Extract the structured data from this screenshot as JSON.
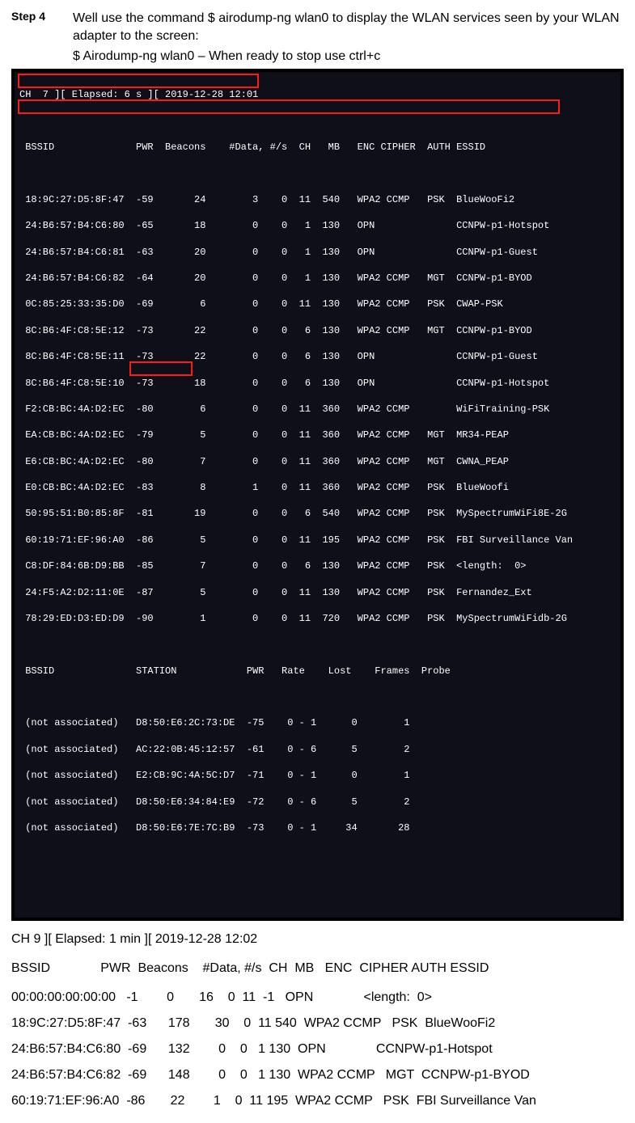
{
  "step": {
    "label": "Step 4",
    "text": "Well use the command $ airodump-ng wlan0 to display the WLAN services seen by your WLAN adapter to the screen:",
    "cmd": "$ Airodump-ng wlan0 – When ready to stop use ctrl+c"
  },
  "terminal": {
    "status": "CH  7 ][ Elapsed: 6 s ][ 2019-12-28 12:01",
    "header": " BSSID              PWR  Beacons    #Data, #/s  CH   MB   ENC CIPHER  AUTH ESSID",
    "rows": [
      " 18:9C:27:D5:8F:47  -59       24        3    0  11  540   WPA2 CCMP   PSK  BlueWooFi2",
      " 24:B6:57:B4:C6:80  -65       18        0    0   1  130   OPN              CCNPW-p1-Hotspot",
      " 24:B6:57:B4:C6:81  -63       20        0    0   1  130   OPN              CCNPW-p1-Guest",
      " 24:B6:57:B4:C6:82  -64       20        0    0   1  130   WPA2 CCMP   MGT  CCNPW-p1-BYOD",
      " 0C:85:25:33:35:D0  -69        6        0    0  11  130   WPA2 CCMP   PSK  CWAP-PSK",
      " 8C:B6:4F:C8:5E:12  -73       22        0    0   6  130   WPA2 CCMP   MGT  CCNPW-p1-BYOD",
      " 8C:B6:4F:C8:5E:11  -73       22        0    0   6  130   OPN              CCNPW-p1-Guest",
      " 8C:B6:4F:C8:5E:10  -73       18        0    0   6  130   OPN              CCNPW-p1-Hotspot",
      " F2:CB:BC:4A:D2:EC  -80        6        0    0  11  360   WPA2 CCMP        WiFiTraining-PSK",
      " EA:CB:BC:4A:D2:EC  -79        5        0    0  11  360   WPA2 CCMP   MGT  MR34-PEAP",
      " E6:CB:BC:4A:D2:EC  -80        7        0    0  11  360   WPA2 CCMP   MGT  CWNA_PEAP",
      " E0:CB:BC:4A:D2:EC  -83        8        1    0  11  360   WPA2 CCMP   PSK  BlueWoofi",
      " 50:95:51:B0:85:8F  -81       19        0    0   6  540   WPA2 CCMP   PSK  MySpectrumWiFi8E-2G",
      " 60:19:71:EF:96:A0  -86        5        0    0  11  195   WPA2 CCMP   PSK  FBI Surveillance Van",
      " C8:DF:84:6B:D9:BB  -85        7        0    0   6  130   WPA2 CCMP   PSK  <length:  0>",
      " 24:F5:A2:D2:11:0E  -87        5        0    0  11  130   WPA2 CCMP   PSK  Fernandez_Ext",
      " 78:29:ED:D3:ED:D9  -90        1        0    0  11  720   WPA2 CCMP   PSK  MySpectrumWiFidb-2G"
    ],
    "stationHeader": " BSSID              STATION            PWR   Rate    Lost    Frames  Probe",
    "stationRows": [
      " (not associated)   D8:50:E6:2C:73:DE  -75    0 - 1      0        1",
      " (not associated)   AC:22:0B:45:12:57  -61    0 - 6      5        2",
      " (not associated)   E2:CB:9C:4A:5C:D7  -71    0 - 1      0        1",
      " (not associated)   D8:50:E6:34:84:E9  -72    0 - 6      5        2",
      " (not associated)   D8:50:E6:7E:7C:B9  -73    0 - 1     34       28"
    ]
  },
  "post": {
    "status": "CH  9 ][ Elapsed: 1 min ][ 2019-12-28 12:02",
    "header": "BSSID              PWR  Beacons    #Data, #/s  CH  MB   ENC  CIPHER AUTH ESSID",
    "rows": [
      "00:00:00:00:00:00   -1        0       16    0  11  -1   OPN              <length:  0>",
      "18:9C:27:D5:8F:47  -63      178       30    0  11 540  WPA2 CCMP   PSK  BlueWooFi2",
      "24:B6:57:B4:C6:80  -69      132        0    0   1 130  OPN              CCNPW-p1-Hotspot",
      "24:B6:57:B4:C6:82  -69      148        0    0   1 130  WPA2 CCMP   MGT  CCNPW-p1-BYOD",
      "60:19:71:EF:96:A0  -86       22        1    0  11 195  WPA2 CCMP   PSK  FBI Surveillance Van"
    ]
  }
}
